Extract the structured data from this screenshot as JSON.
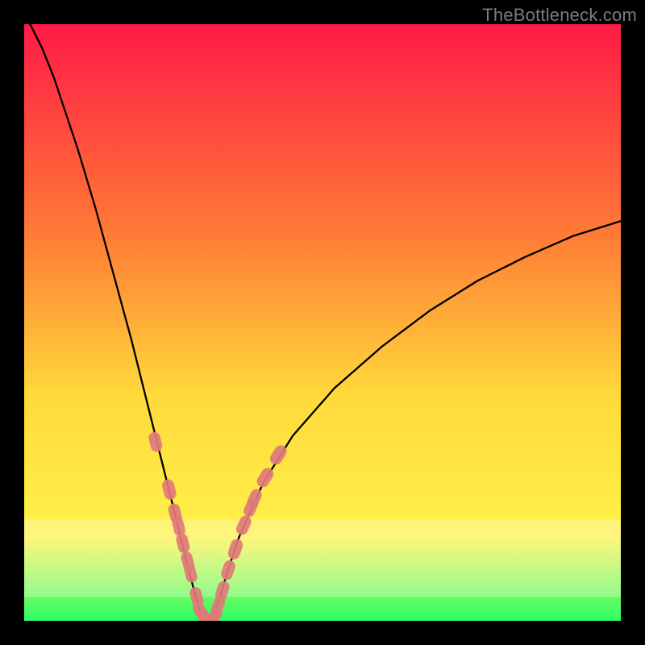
{
  "watermark": "TheBottleneck.com",
  "colors": {
    "page_bg": "#000000",
    "grad_top": "#ff1a46",
    "grad_mid1": "#ff7a36",
    "grad_mid2": "#ffd93a",
    "grad_mid3": "#fff24a",
    "grad_bottom": "#2cff6a",
    "curve": "#000000",
    "marker_fill": "#e07a7a",
    "marker_stroke": "#d46a6a"
  },
  "chart_data": {
    "type": "line",
    "title": "",
    "xlabel": "",
    "ylabel": "",
    "xlim": [
      0,
      100
    ],
    "ylim": [
      0,
      100
    ],
    "series": [
      {
        "name": "bottleneck-curve",
        "x": [
          1,
          3,
          5,
          7,
          9,
          12,
          15,
          18,
          21,
          23.5,
          25.5,
          27.2,
          28.5,
          29.5,
          30.3,
          31.0,
          31.8,
          32.8,
          34.0,
          36.0,
          40.0,
          45.0,
          52.0,
          60.0,
          68.0,
          76.0,
          84.0,
          92.0,
          100.0
        ],
        "y": [
          100,
          96,
          91,
          85,
          79,
          69,
          58,
          47,
          35,
          25,
          17,
          10,
          5,
          1.5,
          0.2,
          0.2,
          1.2,
          4,
          8,
          14,
          23,
          31,
          39,
          46,
          52,
          57,
          61,
          64.5,
          67
        ]
      }
    ],
    "markers": {
      "name": "highlighted-points",
      "points": [
        {
          "x": 22.0,
          "y": 30.0,
          "r": 2.2
        },
        {
          "x": 24.3,
          "y": 22.0,
          "r": 2.4
        },
        {
          "x": 25.3,
          "y": 18.0,
          "r": 2.2
        },
        {
          "x": 25.9,
          "y": 15.8,
          "r": 2.0
        },
        {
          "x": 26.6,
          "y": 13.0,
          "r": 2.2
        },
        {
          "x": 27.4,
          "y": 10.0,
          "r": 2.0
        },
        {
          "x": 27.9,
          "y": 8.0,
          "r": 2.0
        },
        {
          "x": 28.9,
          "y": 4.0,
          "r": 2.2
        },
        {
          "x": 29.6,
          "y": 1.5,
          "r": 2.2
        },
        {
          "x": 30.3,
          "y": 0.3,
          "r": 2.1
        },
        {
          "x": 31.0,
          "y": 0.2,
          "r": 2.0
        },
        {
          "x": 31.8,
          "y": 0.7,
          "r": 2.2
        },
        {
          "x": 32.5,
          "y": 2.5,
          "r": 2.0
        },
        {
          "x": 33.2,
          "y": 5.0,
          "r": 2.2
        },
        {
          "x": 34.2,
          "y": 8.5,
          "r": 2.2
        },
        {
          "x": 35.4,
          "y": 12.0,
          "r": 2.4
        },
        {
          "x": 36.8,
          "y": 16.0,
          "r": 2.2
        },
        {
          "x": 38.0,
          "y": 19.0,
          "r": 2.0
        },
        {
          "x": 38.6,
          "y": 20.5,
          "r": 2.0
        },
        {
          "x": 40.4,
          "y": 24.0,
          "r": 2.4
        },
        {
          "x": 42.6,
          "y": 27.8,
          "r": 2.4
        }
      ]
    },
    "green_band": {
      "y_start": 0,
      "y_end": 2.0
    }
  }
}
